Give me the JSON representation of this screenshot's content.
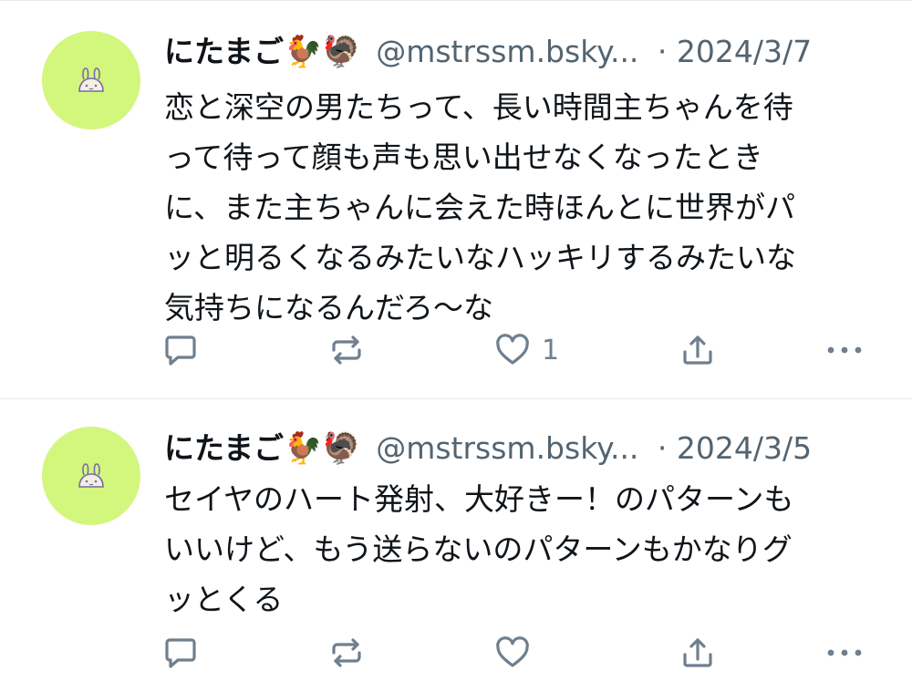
{
  "colors": {
    "avatar_bg": "#d3f67d",
    "icon_gray": "#6f7f8e",
    "text_primary": "#0f1419",
    "text_secondary": "#536471"
  },
  "posts": [
    {
      "display_name": "にたまご",
      "name_emojis": "🐓🦃",
      "handle": "@mstrssm.bsky...",
      "separator": "·",
      "timestamp": "2024/3/7",
      "text": "恋と深空の男たちって、長い時間主ちゃんを待\nって待って顔も声も思い出せなくなったとき\nに、また主ちゃんに会えた時ほんとに世界がパ\nッと明るくなるみたいなハッキリするみたいな\n気持ちになるんだろ〜な",
      "like_count": "1",
      "icons": [
        "reply-icon",
        "repost-icon",
        "like-icon",
        "share-icon",
        "more-icon"
      ]
    },
    {
      "display_name": "にたまご",
      "name_emojis": "🐓🦃",
      "handle": "@mstrssm.bsky...",
      "separator": "·",
      "timestamp": "2024/3/5",
      "text": "セイヤのハート発射、大好きー！のパターンも\nいいけど、もう送らないのパターンもかなりグ\nッとくる",
      "like_count": "",
      "icons": [
        "reply-icon",
        "repost-icon",
        "like-icon",
        "share-icon",
        "more-icon"
      ]
    }
  ]
}
